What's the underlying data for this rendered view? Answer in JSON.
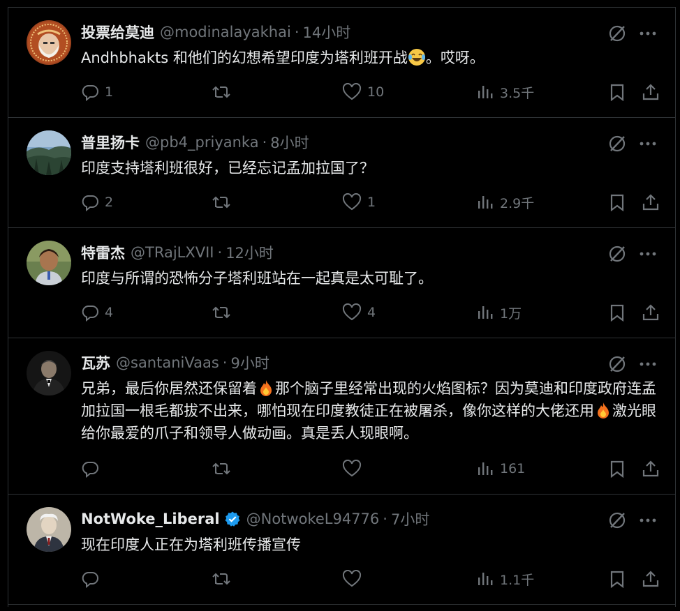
{
  "tweets": [
    {
      "name": "投票给莫迪",
      "handle": "@modinalayakhai",
      "time": "14小时",
      "verified": false,
      "text_before": "Andhbhakts 和他们的幻想希望印度为塔利班开战",
      "text_after": "。哎呀。",
      "emoji": "laughing-crying-emoji",
      "replies": "1",
      "retweets": "",
      "likes": "10",
      "views": "3.5千"
    },
    {
      "name": "普里扬卡",
      "handle": "@pb4_priyanka",
      "time": "8小时",
      "verified": false,
      "text": "印度支持塔利班很好，已经忘记孟加拉国了？",
      "replies": "2",
      "retweets": "",
      "likes": "1",
      "views": "2.9千"
    },
    {
      "name": "特雷杰",
      "handle": "@TRajLXVII",
      "time": "12小时",
      "verified": false,
      "text": "印度与所谓的恐怖分子塔利班站在一起真是太可耻了。",
      "replies": "4",
      "retweets": "",
      "likes": "4",
      "views": "1万"
    },
    {
      "name": "瓦苏",
      "handle": "@santaniVaas",
      "time": "9小时",
      "verified": false,
      "text_part1": "兄弟，最后你居然还保留着",
      "text_part2": "那个脑子里经常出现的火焰图标？因为莫迪和印度政府连孟加拉国一根毛都拔不出来，哪怕现在印度教徒正在被屠杀，像你这样的大佬还用",
      "text_part3": "激光眼给你最爱的爪子和领导人做动画。真是丢人现眼啊。",
      "emoji": "fire-emoji",
      "replies": "",
      "retweets": "",
      "likes": "",
      "views": "161"
    },
    {
      "name": "NotWoke_Liberal",
      "handle": "@NotwokeL94776",
      "time": "7小时",
      "verified": true,
      "text": "现在印度人正在为塔利班传播宣传",
      "replies": "",
      "retweets": "",
      "likes": "",
      "views": "1.1千"
    }
  ],
  "colors": {
    "background": "#000000",
    "text": "#e7e9ea",
    "muted": "#71767b",
    "divider": "#2f3336",
    "verified": "#1d9bf0"
  },
  "icons": [
    "reply-icon",
    "retweet-icon",
    "like-icon",
    "views-icon",
    "bookmark-icon",
    "share-icon",
    "grok-icon",
    "more-icon",
    "verified-badge-icon"
  ]
}
